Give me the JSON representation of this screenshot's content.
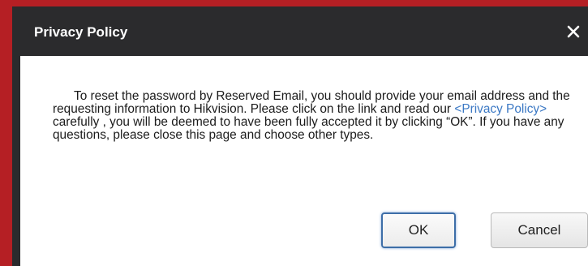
{
  "dialog": {
    "title": "Privacy Policy",
    "close_icon": "close-icon",
    "message": {
      "part1": "To reset the password by Reserved Email, you should provide your email address and the requesting information to Hikvision. Please click on the link and read our ",
      "link_text": "<Privacy Policy>",
      "part2": " carefully , you will be deemed to have been fully accepted it by clicking “OK”. If you have any questions, please close this page and choose other types."
    },
    "ok_label": "OK",
    "cancel_label": "Cancel"
  },
  "colors": {
    "frame_red": "#b51f24",
    "title_bar": "#2b2b2d",
    "link": "#3b78c4",
    "ok_focus_border": "#3d6ea8"
  }
}
